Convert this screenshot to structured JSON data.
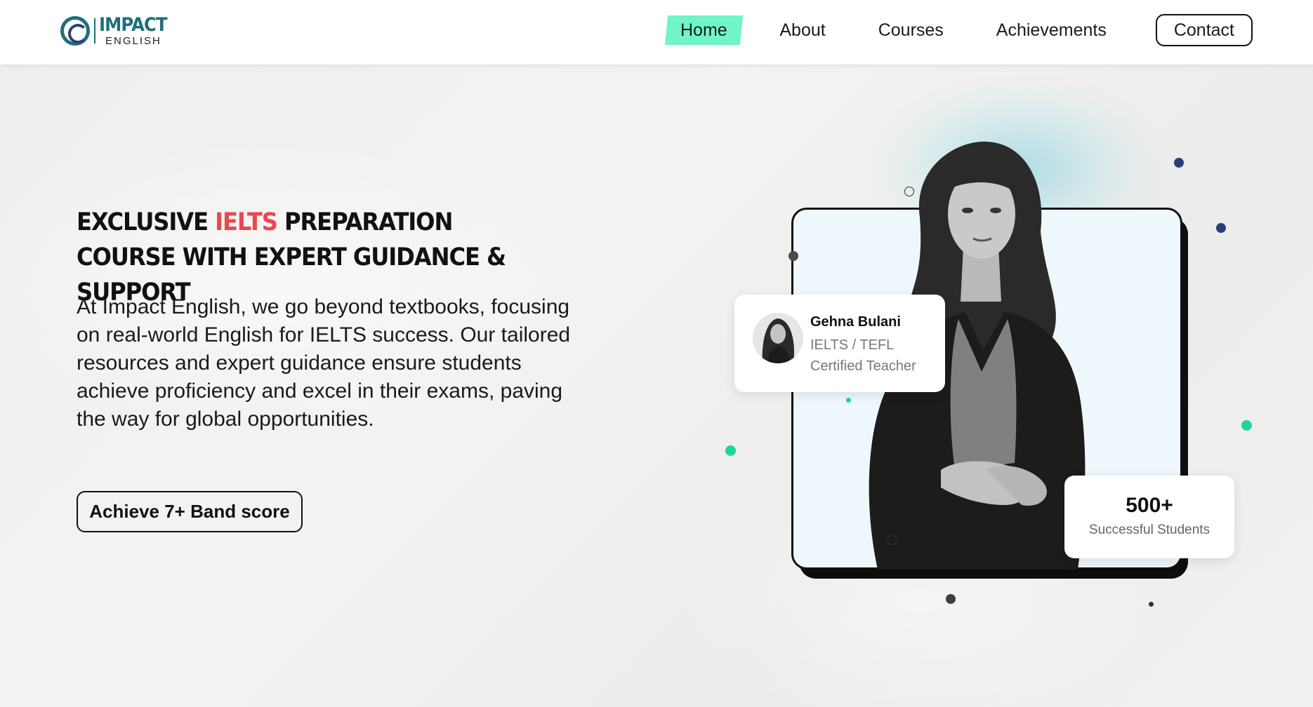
{
  "brand": {
    "title": "IMPACT",
    "subtitle": "ENGLISH"
  },
  "nav": {
    "items": [
      {
        "label": "Home",
        "active": true
      },
      {
        "label": "About",
        "active": false
      },
      {
        "label": "Courses",
        "active": false
      },
      {
        "label": "Achievements",
        "active": false
      }
    ],
    "contact_label": "Contact"
  },
  "hero": {
    "headline_part1": "Exclusive ",
    "headline_highlight": "IELTS",
    "headline_part2": " Preparation Course with Expert Guidance & Support",
    "intro": "At Impact English, we go beyond textbooks, focusing on real-world English for IELTS success. Our tailored resources and expert guidance ensure students achieve proficiency and excel in their exams, paving the way for global opportunities.",
    "cta_label": "Achieve 7+ Band score"
  },
  "teacher": {
    "name": "Gehna Bulani",
    "role": "IELTS / TEFL Certified Teacher"
  },
  "stats": {
    "value": "500+",
    "label": "Successful Students"
  },
  "colors": {
    "accent_mint": "#6ff5c8",
    "highlight_red": "#e8484f",
    "brand_teal": "#1f6f7a",
    "dot_navy": "#2c3e7a",
    "dot_green": "#1fd39c"
  }
}
